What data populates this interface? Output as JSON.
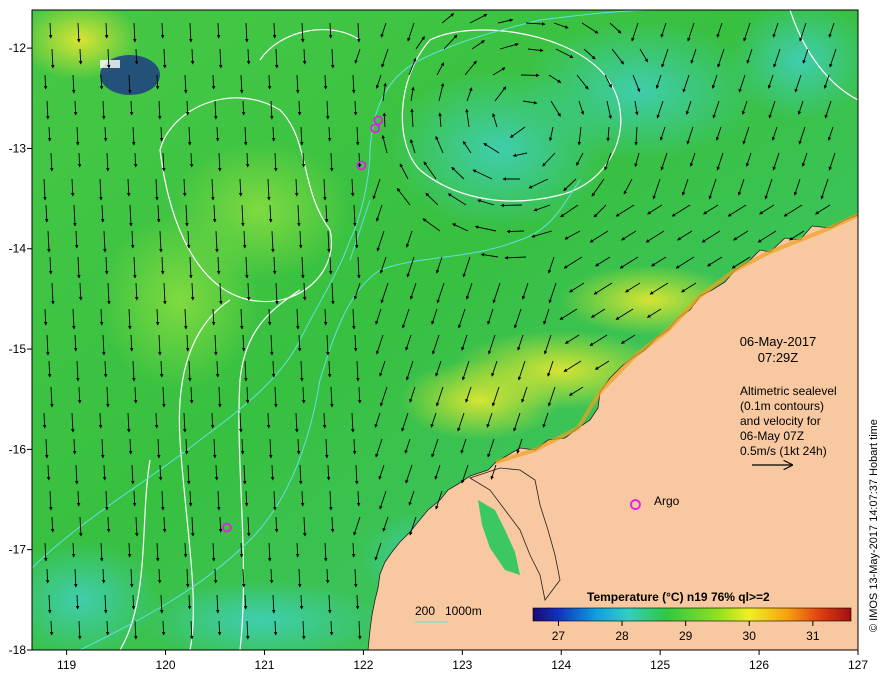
{
  "map": {
    "date": "06-May-2017",
    "time": "07:29Z",
    "legend_lines": [
      "Altimetric sealevel",
      "(0.1m contours)",
      "and velocity for",
      "06-May 07Z",
      "0.5m/s (1kt 24h)"
    ],
    "argo_label": "Argo",
    "depth_label_200": "200",
    "depth_label_1000": "1000m",
    "credit": "© IMOS 13-May-2017 14:07:37 Hobart time",
    "colorbar_title": "Temperature (°C) n19 76% ql>=2",
    "colorbar_ticks": [
      "27",
      "28",
      "29",
      "30",
      "31"
    ],
    "x_ticks": [
      "119",
      "120",
      "121",
      "122",
      "123",
      "124",
      "125",
      "126",
      "127"
    ],
    "y_ticks": [
      "-12",
      "-13",
      "-14",
      "-15",
      "-16",
      "-17",
      "-18"
    ],
    "colors": {
      "land": "#f8c8a0",
      "sea_green": "#3cc83c",
      "sea_cyan": "#40d0b0",
      "warm_yellow": "#d8e830",
      "contour_white": "#ffffff",
      "depth_cyan": "#60e0e0",
      "argo_magenta": "#e020e0"
    },
    "argo_floats": [
      {
        "lon": 122.15,
        "lat": -12.72
      },
      {
        "lon": 122.12,
        "lat": -12.8
      },
      {
        "lon": 121.98,
        "lat": -13.17
      },
      {
        "lon": 120.62,
        "lat": -16.78
      }
    ],
    "argo_legend_marker": {
      "lon": 124.75,
      "lat": -16.55
    }
  }
}
